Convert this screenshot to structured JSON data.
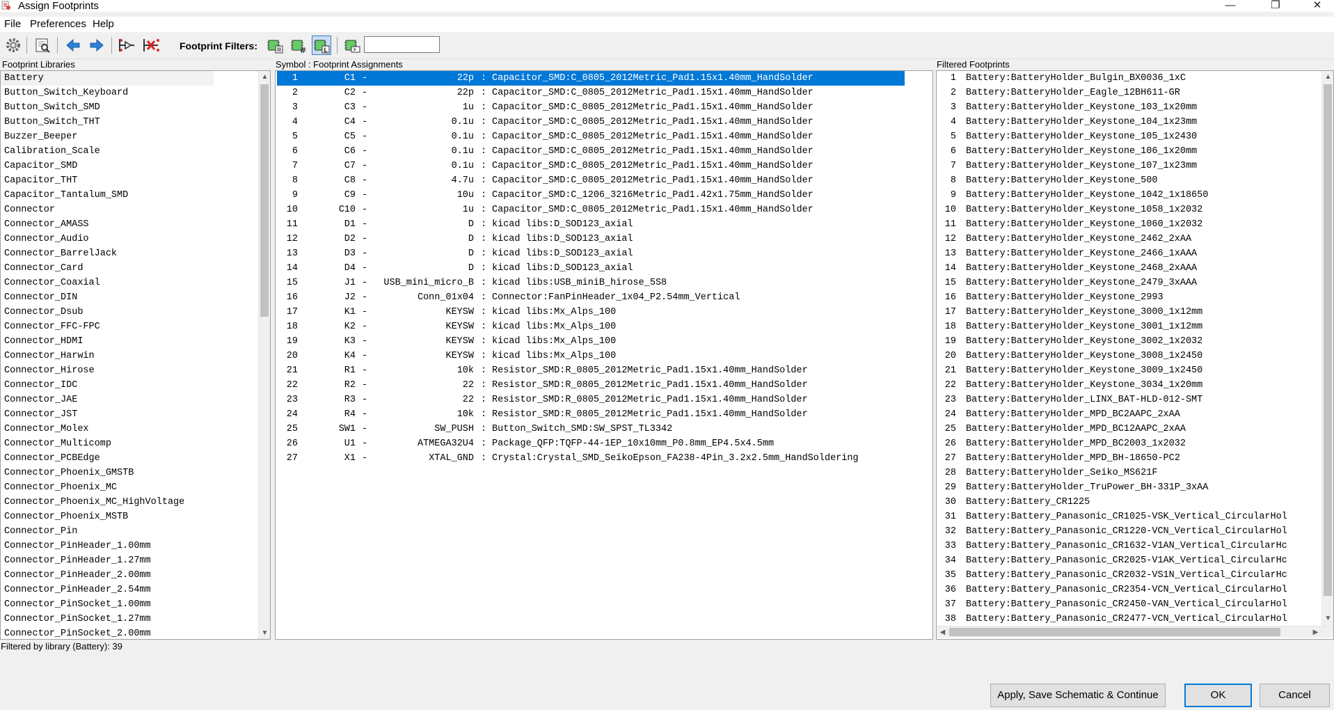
{
  "window": {
    "title": "Assign Footprints",
    "minimize": "—",
    "maximize": "❐",
    "close": "✕"
  },
  "menu": [
    "File",
    "Preferences",
    "Help"
  ],
  "toolbar": {
    "filters_label": "Footprint Filters:",
    "filter_input_value": ""
  },
  "panels": {
    "libraries_header": "Footprint Libraries",
    "assign_header": "Symbol : Footprint Assignments",
    "filtered_header": "Filtered Footprints"
  },
  "libraries": [
    "Battery",
    "Button_Switch_Keyboard",
    "Button_Switch_SMD",
    "Button_Switch_THT",
    "Buzzer_Beeper",
    "Calibration_Scale",
    "Capacitor_SMD",
    "Capacitor_THT",
    "Capacitor_Tantalum_SMD",
    "Connector",
    "Connector_AMASS",
    "Connector_Audio",
    "Connector_BarrelJack",
    "Connector_Card",
    "Connector_Coaxial",
    "Connector_DIN",
    "Connector_Dsub",
    "Connector_FFC-FPC",
    "Connector_HDMI",
    "Connector_Harwin",
    "Connector_Hirose",
    "Connector_IDC",
    "Connector_JAE",
    "Connector_JST",
    "Connector_Molex",
    "Connector_Multicomp",
    "Connector_PCBEdge",
    "Connector_Phoenix_GMSTB",
    "Connector_Phoenix_MC",
    "Connector_Phoenix_MC_HighVoltage",
    "Connector_Phoenix_MSTB",
    "Connector_Pin",
    "Connector_PinHeader_1.00mm",
    "Connector_PinHeader_1.27mm",
    "Connector_PinHeader_2.00mm",
    "Connector_PinHeader_2.54mm",
    "Connector_PinSocket_1.00mm",
    "Connector_PinSocket_1.27mm",
    "Connector_PinSocket_2.00mm"
  ],
  "assignments": [
    {
      "n": "1",
      "ref": "C1",
      "dash": "-",
      "val": "22p",
      "sep": ":",
      "fp": "Capacitor_SMD:C_0805_2012Metric_Pad1.15x1.40mm_HandSolder"
    },
    {
      "n": "2",
      "ref": "C2",
      "dash": "-",
      "val": "22p",
      "sep": ":",
      "fp": "Capacitor_SMD:C_0805_2012Metric_Pad1.15x1.40mm_HandSolder"
    },
    {
      "n": "3",
      "ref": "C3",
      "dash": "-",
      "val": "1u",
      "sep": ":",
      "fp": "Capacitor_SMD:C_0805_2012Metric_Pad1.15x1.40mm_HandSolder"
    },
    {
      "n": "4",
      "ref": "C4",
      "dash": "-",
      "val": "0.1u",
      "sep": ":",
      "fp": "Capacitor_SMD:C_0805_2012Metric_Pad1.15x1.40mm_HandSolder"
    },
    {
      "n": "5",
      "ref": "C5",
      "dash": "-",
      "val": "0.1u",
      "sep": ":",
      "fp": "Capacitor_SMD:C_0805_2012Metric_Pad1.15x1.40mm_HandSolder"
    },
    {
      "n": "6",
      "ref": "C6",
      "dash": "-",
      "val": "0.1u",
      "sep": ":",
      "fp": "Capacitor_SMD:C_0805_2012Metric_Pad1.15x1.40mm_HandSolder"
    },
    {
      "n": "7",
      "ref": "C7",
      "dash": "-",
      "val": "0.1u",
      "sep": ":",
      "fp": "Capacitor_SMD:C_0805_2012Metric_Pad1.15x1.40mm_HandSolder"
    },
    {
      "n": "8",
      "ref": "C8",
      "dash": "-",
      "val": "4.7u",
      "sep": ":",
      "fp": "Capacitor_SMD:C_0805_2012Metric_Pad1.15x1.40mm_HandSolder"
    },
    {
      "n": "9",
      "ref": "C9",
      "dash": "-",
      "val": "10u",
      "sep": ":",
      "fp": "Capacitor_SMD:C_1206_3216Metric_Pad1.42x1.75mm_HandSolder"
    },
    {
      "n": "10",
      "ref": "C10",
      "dash": "-",
      "val": "1u",
      "sep": ":",
      "fp": "Capacitor_SMD:C_0805_2012Metric_Pad1.15x1.40mm_HandSolder"
    },
    {
      "n": "11",
      "ref": "D1",
      "dash": "-",
      "val": "D",
      "sep": ":",
      "fp": "kicad libs:D_SOD123_axial"
    },
    {
      "n": "12",
      "ref": "D2",
      "dash": "-",
      "val": "D",
      "sep": ":",
      "fp": "kicad libs:D_SOD123_axial"
    },
    {
      "n": "13",
      "ref": "D3",
      "dash": "-",
      "val": "D",
      "sep": ":",
      "fp": "kicad libs:D_SOD123_axial"
    },
    {
      "n": "14",
      "ref": "D4",
      "dash": "-",
      "val": "D",
      "sep": ":",
      "fp": "kicad libs:D_SOD123_axial"
    },
    {
      "n": "15",
      "ref": "J1",
      "dash": "-",
      "val": "USB_mini_micro_B",
      "sep": ":",
      "fp": "kicad libs:USB_miniB_hirose_5S8"
    },
    {
      "n": "16",
      "ref": "J2",
      "dash": "-",
      "val": "Conn_01x04",
      "sep": ":",
      "fp": "Connector:FanPinHeader_1x04_P2.54mm_Vertical"
    },
    {
      "n": "17",
      "ref": "K1",
      "dash": "-",
      "val": "KEYSW",
      "sep": ":",
      "fp": "kicad libs:Mx_Alps_100"
    },
    {
      "n": "18",
      "ref": "K2",
      "dash": "-",
      "val": "KEYSW",
      "sep": ":",
      "fp": "kicad libs:Mx_Alps_100"
    },
    {
      "n": "19",
      "ref": "K3",
      "dash": "-",
      "val": "KEYSW",
      "sep": ":",
      "fp": "kicad libs:Mx_Alps_100"
    },
    {
      "n": "20",
      "ref": "K4",
      "dash": "-",
      "val": "KEYSW",
      "sep": ":",
      "fp": "kicad libs:Mx_Alps_100"
    },
    {
      "n": "21",
      "ref": "R1",
      "dash": "-",
      "val": "10k",
      "sep": ":",
      "fp": "Resistor_SMD:R_0805_2012Metric_Pad1.15x1.40mm_HandSolder"
    },
    {
      "n": "22",
      "ref": "R2",
      "dash": "-",
      "val": "22",
      "sep": ":",
      "fp": "Resistor_SMD:R_0805_2012Metric_Pad1.15x1.40mm_HandSolder"
    },
    {
      "n": "23",
      "ref": "R3",
      "dash": "-",
      "val": "22",
      "sep": ":",
      "fp": "Resistor_SMD:R_0805_2012Metric_Pad1.15x1.40mm_HandSolder"
    },
    {
      "n": "24",
      "ref": "R4",
      "dash": "-",
      "val": "10k",
      "sep": ":",
      "fp": "Resistor_SMD:R_0805_2012Metric_Pad1.15x1.40mm_HandSolder"
    },
    {
      "n": "25",
      "ref": "SW1",
      "dash": "-",
      "val": "SW_PUSH",
      "sep": ":",
      "fp": "Button_Switch_SMD:SW_SPST_TL3342"
    },
    {
      "n": "26",
      "ref": "U1",
      "dash": "-",
      "val": "ATMEGA32U4",
      "sep": ":",
      "fp": "Package_QFP:TQFP-44-1EP_10x10mm_P0.8mm_EP4.5x4.5mm"
    },
    {
      "n": "27",
      "ref": "X1",
      "dash": "-",
      "val": "XTAL_GND",
      "sep": ":",
      "fp": "Crystal:Crystal_SMD_SeikoEpson_FA238-4Pin_3.2x2.5mm_HandSoldering"
    }
  ],
  "filtered": [
    {
      "n": "1",
      "fp": "Battery:BatteryHolder_Bulgin_BX0036_1xC"
    },
    {
      "n": "2",
      "fp": "Battery:BatteryHolder_Eagle_12BH611-GR"
    },
    {
      "n": "3",
      "fp": "Battery:BatteryHolder_Keystone_103_1x20mm"
    },
    {
      "n": "4",
      "fp": "Battery:BatteryHolder_Keystone_104_1x23mm"
    },
    {
      "n": "5",
      "fp": "Battery:BatteryHolder_Keystone_105_1x2430"
    },
    {
      "n": "6",
      "fp": "Battery:BatteryHolder_Keystone_106_1x20mm"
    },
    {
      "n": "7",
      "fp": "Battery:BatteryHolder_Keystone_107_1x23mm"
    },
    {
      "n": "8",
      "fp": "Battery:BatteryHolder_Keystone_500"
    },
    {
      "n": "9",
      "fp": "Battery:BatteryHolder_Keystone_1042_1x18650"
    },
    {
      "n": "10",
      "fp": "Battery:BatteryHolder_Keystone_1058_1x2032"
    },
    {
      "n": "11",
      "fp": "Battery:BatteryHolder_Keystone_1060_1x2032"
    },
    {
      "n": "12",
      "fp": "Battery:BatteryHolder_Keystone_2462_2xAA"
    },
    {
      "n": "13",
      "fp": "Battery:BatteryHolder_Keystone_2466_1xAAA"
    },
    {
      "n": "14",
      "fp": "Battery:BatteryHolder_Keystone_2468_2xAAA"
    },
    {
      "n": "15",
      "fp": "Battery:BatteryHolder_Keystone_2479_3xAAA"
    },
    {
      "n": "16",
      "fp": "Battery:BatteryHolder_Keystone_2993"
    },
    {
      "n": "17",
      "fp": "Battery:BatteryHolder_Keystone_3000_1x12mm"
    },
    {
      "n": "18",
      "fp": "Battery:BatteryHolder_Keystone_3001_1x12mm"
    },
    {
      "n": "19",
      "fp": "Battery:BatteryHolder_Keystone_3002_1x2032"
    },
    {
      "n": "20",
      "fp": "Battery:BatteryHolder_Keystone_3008_1x2450"
    },
    {
      "n": "21",
      "fp": "Battery:BatteryHolder_Keystone_3009_1x2450"
    },
    {
      "n": "22",
      "fp": "Battery:BatteryHolder_Keystone_3034_1x20mm"
    },
    {
      "n": "23",
      "fp": "Battery:BatteryHolder_LINX_BAT-HLD-012-SMT"
    },
    {
      "n": "24",
      "fp": "Battery:BatteryHolder_MPD_BC2AAPC_2xAA"
    },
    {
      "n": "25",
      "fp": "Battery:BatteryHolder_MPD_BC12AAPC_2xAA"
    },
    {
      "n": "26",
      "fp": "Battery:BatteryHolder_MPD_BC2003_1x2032"
    },
    {
      "n": "27",
      "fp": "Battery:BatteryHolder_MPD_BH-18650-PC2"
    },
    {
      "n": "28",
      "fp": "Battery:BatteryHolder_Seiko_MS621F"
    },
    {
      "n": "29",
      "fp": "Battery:BatteryHolder_TruPower_BH-331P_3xAA"
    },
    {
      "n": "30",
      "fp": "Battery:Battery_CR1225"
    },
    {
      "n": "31",
      "fp": "Battery:Battery_Panasonic_CR1025-VSK_Vertical_CircularHol"
    },
    {
      "n": "32",
      "fp": "Battery:Battery_Panasonic_CR1220-VCN_Vertical_CircularHol"
    },
    {
      "n": "33",
      "fp": "Battery:Battery_Panasonic_CR1632-V1AN_Vertical_CircularHc"
    },
    {
      "n": "34",
      "fp": "Battery:Battery_Panasonic_CR2025-V1AK_Vertical_CircularHc"
    },
    {
      "n": "35",
      "fp": "Battery:Battery_Panasonic_CR2032-VS1N_Vertical_CircularHc"
    },
    {
      "n": "36",
      "fp": "Battery:Battery_Panasonic_CR2354-VCN_Vertical_CircularHol"
    },
    {
      "n": "37",
      "fp": "Battery:Battery_Panasonic_CR2450-VAN_Vertical_CircularHol"
    },
    {
      "n": "38",
      "fp": "Battery:Battery_Panasonic_CR2477-VCN_Vertical_CircularHol"
    }
  ],
  "status": "Filtered by library (Battery): 39",
  "buttons": {
    "apply": "Apply, Save Schematic & Continue",
    "ok": "OK",
    "cancel": "Cancel"
  },
  "colors": {
    "selection": "#0078d7",
    "panel_bg": "#ffffff",
    "window_bg": "#f0f0f0"
  }
}
